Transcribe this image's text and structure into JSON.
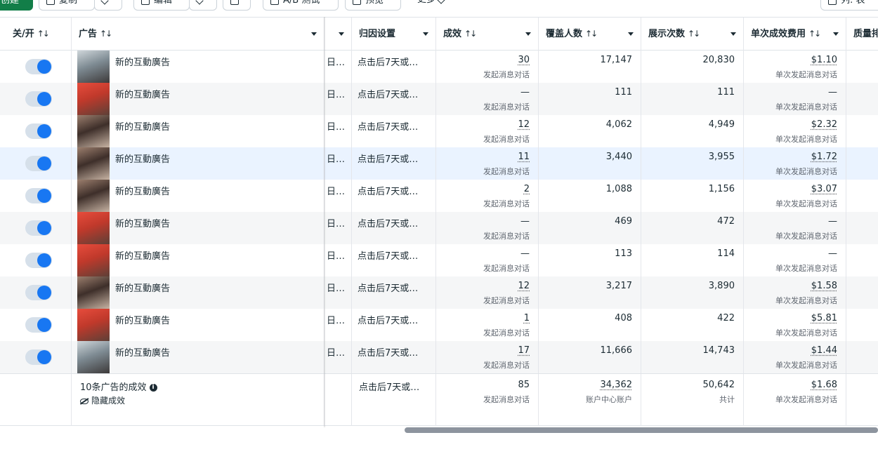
{
  "toolbar": {
    "create_label": "创建",
    "duplicate_label": "复制",
    "edit_label": "编辑",
    "ab_test_label": "A/B 测试",
    "preview_label": "预览",
    "more_label": "更多",
    "columns_label": "列: 表"
  },
  "header": {
    "toggle": "关/开",
    "ad": "广告",
    "attribution": "归因设置",
    "results": "成效",
    "reach": "覆盖人数",
    "impressions": "展示次数",
    "cost_per_result": "单次成效费用",
    "quality": "质量排"
  },
  "rows": [
    {
      "name": "新的互動廣告",
      "bid": "日…",
      "attribution": "点击后7天或…",
      "results": "30",
      "results_sub": "发起消息对话",
      "reach": "17,147",
      "impressions": "20,830",
      "cost": "$1.10",
      "cost_sub": "单次发起消息对话",
      "on": true
    },
    {
      "name": "新的互動廣告",
      "bid": "日…",
      "attribution": "点击后7天或…",
      "results": "—",
      "results_sub": "发起消息对话",
      "reach": "111",
      "impressions": "111",
      "cost": "—",
      "cost_sub": "单次发起消息对话",
      "on": true
    },
    {
      "name": "新的互動廣告",
      "bid": "日…",
      "attribution": "点击后7天或…",
      "results": "12",
      "results_sub": "发起消息对话",
      "reach": "4,062",
      "impressions": "4,949",
      "cost": "$2.32",
      "cost_sub": "单次发起消息对话",
      "on": true
    },
    {
      "name": "新的互動廣告",
      "bid": "日…",
      "attribution": "点击后7天或…",
      "results": "11",
      "results_sub": "发起消息对话",
      "reach": "3,440",
      "impressions": "3,955",
      "cost": "$1.72",
      "cost_sub": "单次发起消息对话",
      "on": true
    },
    {
      "name": "新的互動廣告",
      "bid": "日…",
      "attribution": "点击后7天或…",
      "results": "2",
      "results_sub": "发起消息对话",
      "reach": "1,088",
      "impressions": "1,156",
      "cost": "$3.07",
      "cost_sub": "单次发起消息对话",
      "on": true
    },
    {
      "name": "新的互動廣告",
      "bid": "日…",
      "attribution": "点击后7天或…",
      "results": "—",
      "results_sub": "发起消息对话",
      "reach": "469",
      "impressions": "472",
      "cost": "—",
      "cost_sub": "单次发起消息对话",
      "on": true
    },
    {
      "name": "新的互動廣告",
      "bid": "日…",
      "attribution": "点击后7天或…",
      "results": "—",
      "results_sub": "发起消息对话",
      "reach": "113",
      "impressions": "114",
      "cost": "—",
      "cost_sub": "单次发起消息对话",
      "on": true
    },
    {
      "name": "新的互動廣告",
      "bid": "日…",
      "attribution": "点击后7天或…",
      "results": "12",
      "results_sub": "发起消息对话",
      "reach": "3,217",
      "impressions": "3,890",
      "cost": "$1.58",
      "cost_sub": "单次发起消息对话",
      "on": true
    },
    {
      "name": "新的互動廣告",
      "bid": "日…",
      "attribution": "点击后7天或…",
      "results": "1",
      "results_sub": "发起消息对话",
      "reach": "408",
      "impressions": "422",
      "cost": "$5.81",
      "cost_sub": "单次发起消息对话",
      "on": true
    },
    {
      "name": "新的互動廣告",
      "bid": "日…",
      "attribution": "点击后7天或…",
      "results": "17",
      "results_sub": "发起消息对话",
      "reach": "11,666",
      "impressions": "14,743",
      "cost": "$1.44",
      "cost_sub": "单次发起消息对话",
      "on": true
    }
  ],
  "footer": {
    "summary": "10条广告的成效",
    "hide_results": "隐藏成效",
    "attribution": "点击后7天或…",
    "results": "85",
    "results_sub": "发起消息对话",
    "reach": "34,362",
    "reach_sub": "账户中心账户",
    "impressions": "50,642",
    "impressions_sub": "共计",
    "cost": "$1.68",
    "cost_sub": "单次发起消息对话"
  },
  "colors": {
    "toggle_on": "#1877f2",
    "create_button": "#127e48",
    "highlight_row": "#eaf3ff"
  }
}
